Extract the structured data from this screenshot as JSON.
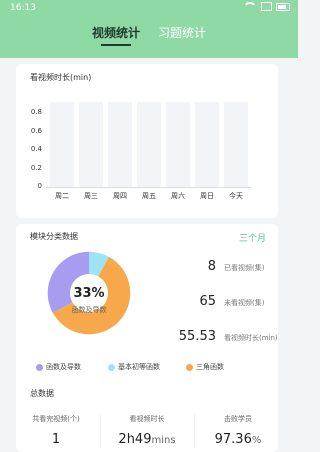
{
  "status_bar": {
    "time": "16:13",
    "icons": [
      "wifi-icon",
      "sim-icon",
      "battery-icon"
    ]
  },
  "tabs": [
    {
      "label": "视频统计",
      "active": true
    },
    {
      "label": "习题统计",
      "active": false
    }
  ],
  "weekly_chart": {
    "title": "看视频时长(min)"
  },
  "chart_data": {
    "type": "bar",
    "title": "看视频时长(min)",
    "categories": [
      "周二",
      "周三",
      "周四",
      "周五",
      "周六",
      "周日",
      "今天"
    ],
    "values": [
      0,
      0,
      0,
      0,
      0,
      0,
      0
    ],
    "ylim": [
      0,
      1
    ],
    "yticks": [
      "0",
      "0.2",
      "0.4",
      "0.6",
      "0.8"
    ],
    "grid": false
  },
  "modules": {
    "title": "模块分类数据",
    "range": "三个月",
    "donut": {
      "percent": "33%",
      "label": "函数及导数",
      "segments": [
        {
          "name": "函数及导数",
          "value": 33,
          "color": "#a79cf0"
        },
        {
          "name": "基本初等函数",
          "value": 8,
          "color": "#9ee3f5"
        },
        {
          "name": "三角函数",
          "value": 59,
          "color": "#f6a84b"
        }
      ]
    },
    "stats": [
      {
        "value": "8",
        "label": "已看视频(集)"
      },
      {
        "value": "65",
        "label": "未看视频(集)"
      },
      {
        "value": "55.53",
        "label": "看视频时长(min)"
      }
    ],
    "legend": [
      {
        "label": "函数及导数",
        "color": "#a79cf0"
      },
      {
        "label": "基本初等函数",
        "color": "#9ee3f5"
      },
      {
        "label": "三角函数",
        "color": "#f6a84b"
      }
    ]
  },
  "totals": {
    "title": "总数据",
    "columns": [
      {
        "label": "共看完视频(个)",
        "value": "1",
        "unit": ""
      },
      {
        "label": "看视频时长",
        "value": "2h49",
        "unit": "mins"
      },
      {
        "label": "击败学员",
        "value": "97.36",
        "unit": "%"
      }
    ]
  },
  "colors": {
    "header_green": "#8fd9a4",
    "accent_green": "#58c88f"
  }
}
